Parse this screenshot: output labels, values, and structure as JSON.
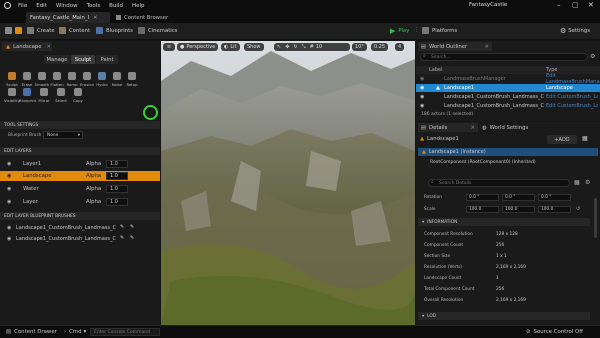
{
  "menu": {
    "items": [
      "File",
      "Edit",
      "Window",
      "Tools",
      "Build",
      "Help"
    ],
    "app_title": "FantasyCastle"
  },
  "tabs": {
    "map_tab": "Fantasy_Castle_Main_I",
    "content_browser": "Content Browser"
  },
  "toolbar": {
    "create": "Create",
    "content": "Content",
    "blueprints": "Blueprints",
    "cinematics": "Cinematics",
    "play": "Play",
    "platforms": "Platforms",
    "settings": "Settings"
  },
  "left_panel": {
    "tab": "Landscape",
    "modes": [
      "Manage",
      "Sculpt",
      "Paint"
    ],
    "tools": [
      "Sculpt",
      "Erase",
      "Smooth",
      "Flatten",
      "Ramp",
      "Erosion",
      "Hydro",
      "Noise",
      "Retop",
      "Visibility",
      "Blueprint",
      "Mirror",
      "Select",
      "Copy"
    ],
    "tool_settings": "TOOL SETTINGS",
    "brush_label": "Blueprint Brush",
    "brush_value": "None",
    "edit_layers": "EDIT LAYERS",
    "layers": [
      {
        "name": "Layer1",
        "alpha_label": "Alpha",
        "alpha": "1.0",
        "selected": false
      },
      {
        "name": "Landscape",
        "alpha_label": "Alpha",
        "alpha": "1.0",
        "selected": true
      },
      {
        "name": "Water",
        "alpha_label": "Alpha",
        "alpha": "1.0",
        "selected": false
      },
      {
        "name": "Layer",
        "alpha_label": "Alpha",
        "alpha": "1.0",
        "selected": false
      }
    ],
    "bp_brushes_header": "EDIT LAYER BLUEPRINT BRUSHES",
    "bp_brushes": [
      "Landscape1_CustomBrush_Landmass_C",
      "Landscape1_CustomBrush_Landmass_C"
    ]
  },
  "viewport": {
    "perspective": "Perspective",
    "lit": "Lit",
    "show": "Show",
    "fov": "10",
    "angle": "10°",
    "speed": "0.25",
    "cam": "4"
  },
  "outliner": {
    "title": "World Outliner",
    "search_placeholder": "Search...",
    "col_label": "Label",
    "col_type": "Type",
    "rows": [
      {
        "label": "LandmassBrushManager",
        "type": "Edit LandmassBrushManager",
        "state": "dim"
      },
      {
        "label": "Landscape1",
        "type": "Landscape",
        "state": "selected"
      },
      {
        "label": "Landscape1_CustomBrush_Landmass_C",
        "type": "Edit CustomBrush_Landmass",
        "state": "normal"
      },
      {
        "label": "Landscape1_CustomBrush_Landmass_C",
        "type": "Edit CustomBrush_Landmass",
        "state": "normal"
      }
    ],
    "footer": "186 actors (1 selected)"
  },
  "details": {
    "tab": "Details",
    "world_tab": "World Settings",
    "object": "Landscape1",
    "add_label": "+ADD",
    "instance_label": "Landscape1 (Instance)",
    "component": "RootComponent (RootComponent0) (Inherited)",
    "search_placeholder": "Search Details",
    "transform": [
      {
        "label": "Rotation",
        "values": [
          "0.0 °",
          "0.0 °",
          "0.0 °"
        ]
      },
      {
        "label": "Scale",
        "values": [
          "100.0",
          "100.0",
          "100.0"
        ]
      }
    ],
    "information": "INFORMATION",
    "info_rows": [
      {
        "label": "Component Resolution",
        "value": "128 x 128"
      },
      {
        "label": "Component Count",
        "value": "256"
      },
      {
        "label": "Section Size",
        "value": "1 x 1"
      },
      {
        "label": "Resolution (Verts)",
        "value": "2,169 x 2,169"
      },
      {
        "label": "Landscape Count",
        "value": "1"
      },
      {
        "label": "Total Component Count",
        "value": "256"
      },
      {
        "label": "Overall Resolution",
        "value": "2,169 x 2,169"
      }
    ],
    "lod": "LOD"
  },
  "status": {
    "content_drawer": "Content Drawer",
    "cmd": "Cmd",
    "console_placeholder": "Enter Console Command",
    "source_control": "Source Control Off"
  },
  "colors": {
    "accent_orange": "#e08a0e",
    "selection_blue": "#1f8ad2",
    "play_green": "#2fbf46"
  }
}
